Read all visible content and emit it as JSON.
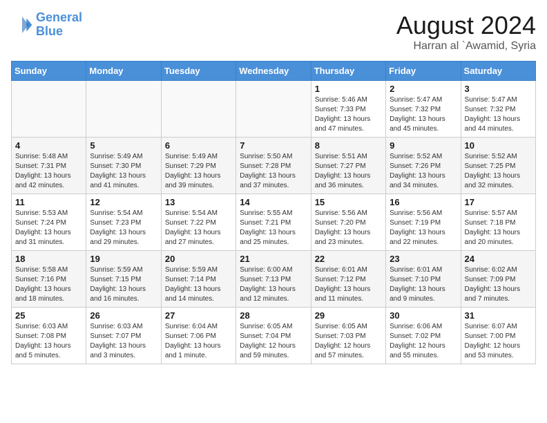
{
  "logo": {
    "line1": "General",
    "line2": "Blue"
  },
  "title": "August 2024",
  "location": "Harran al `Awamid, Syria",
  "days_of_week": [
    "Sunday",
    "Monday",
    "Tuesday",
    "Wednesday",
    "Thursday",
    "Friday",
    "Saturday"
  ],
  "weeks": [
    [
      {
        "day": "",
        "info": ""
      },
      {
        "day": "",
        "info": ""
      },
      {
        "day": "",
        "info": ""
      },
      {
        "day": "",
        "info": ""
      },
      {
        "day": "1",
        "info": "Sunrise: 5:46 AM\nSunset: 7:33 PM\nDaylight: 13 hours\nand 47 minutes."
      },
      {
        "day": "2",
        "info": "Sunrise: 5:47 AM\nSunset: 7:32 PM\nDaylight: 13 hours\nand 45 minutes."
      },
      {
        "day": "3",
        "info": "Sunrise: 5:47 AM\nSunset: 7:32 PM\nDaylight: 13 hours\nand 44 minutes."
      }
    ],
    [
      {
        "day": "4",
        "info": "Sunrise: 5:48 AM\nSunset: 7:31 PM\nDaylight: 13 hours\nand 42 minutes."
      },
      {
        "day": "5",
        "info": "Sunrise: 5:49 AM\nSunset: 7:30 PM\nDaylight: 13 hours\nand 41 minutes."
      },
      {
        "day": "6",
        "info": "Sunrise: 5:49 AM\nSunset: 7:29 PM\nDaylight: 13 hours\nand 39 minutes."
      },
      {
        "day": "7",
        "info": "Sunrise: 5:50 AM\nSunset: 7:28 PM\nDaylight: 13 hours\nand 37 minutes."
      },
      {
        "day": "8",
        "info": "Sunrise: 5:51 AM\nSunset: 7:27 PM\nDaylight: 13 hours\nand 36 minutes."
      },
      {
        "day": "9",
        "info": "Sunrise: 5:52 AM\nSunset: 7:26 PM\nDaylight: 13 hours\nand 34 minutes."
      },
      {
        "day": "10",
        "info": "Sunrise: 5:52 AM\nSunset: 7:25 PM\nDaylight: 13 hours\nand 32 minutes."
      }
    ],
    [
      {
        "day": "11",
        "info": "Sunrise: 5:53 AM\nSunset: 7:24 PM\nDaylight: 13 hours\nand 31 minutes."
      },
      {
        "day": "12",
        "info": "Sunrise: 5:54 AM\nSunset: 7:23 PM\nDaylight: 13 hours\nand 29 minutes."
      },
      {
        "day": "13",
        "info": "Sunrise: 5:54 AM\nSunset: 7:22 PM\nDaylight: 13 hours\nand 27 minutes."
      },
      {
        "day": "14",
        "info": "Sunrise: 5:55 AM\nSunset: 7:21 PM\nDaylight: 13 hours\nand 25 minutes."
      },
      {
        "day": "15",
        "info": "Sunrise: 5:56 AM\nSunset: 7:20 PM\nDaylight: 13 hours\nand 23 minutes."
      },
      {
        "day": "16",
        "info": "Sunrise: 5:56 AM\nSunset: 7:19 PM\nDaylight: 13 hours\nand 22 minutes."
      },
      {
        "day": "17",
        "info": "Sunrise: 5:57 AM\nSunset: 7:18 PM\nDaylight: 13 hours\nand 20 minutes."
      }
    ],
    [
      {
        "day": "18",
        "info": "Sunrise: 5:58 AM\nSunset: 7:16 PM\nDaylight: 13 hours\nand 18 minutes."
      },
      {
        "day": "19",
        "info": "Sunrise: 5:59 AM\nSunset: 7:15 PM\nDaylight: 13 hours\nand 16 minutes."
      },
      {
        "day": "20",
        "info": "Sunrise: 5:59 AM\nSunset: 7:14 PM\nDaylight: 13 hours\nand 14 minutes."
      },
      {
        "day": "21",
        "info": "Sunrise: 6:00 AM\nSunset: 7:13 PM\nDaylight: 13 hours\nand 12 minutes."
      },
      {
        "day": "22",
        "info": "Sunrise: 6:01 AM\nSunset: 7:12 PM\nDaylight: 13 hours\nand 11 minutes."
      },
      {
        "day": "23",
        "info": "Sunrise: 6:01 AM\nSunset: 7:10 PM\nDaylight: 13 hours\nand 9 minutes."
      },
      {
        "day": "24",
        "info": "Sunrise: 6:02 AM\nSunset: 7:09 PM\nDaylight: 13 hours\nand 7 minutes."
      }
    ],
    [
      {
        "day": "25",
        "info": "Sunrise: 6:03 AM\nSunset: 7:08 PM\nDaylight: 13 hours\nand 5 minutes."
      },
      {
        "day": "26",
        "info": "Sunrise: 6:03 AM\nSunset: 7:07 PM\nDaylight: 13 hours\nand 3 minutes."
      },
      {
        "day": "27",
        "info": "Sunrise: 6:04 AM\nSunset: 7:06 PM\nDaylight: 13 hours\nand 1 minute."
      },
      {
        "day": "28",
        "info": "Sunrise: 6:05 AM\nSunset: 7:04 PM\nDaylight: 12 hours\nand 59 minutes."
      },
      {
        "day": "29",
        "info": "Sunrise: 6:05 AM\nSunset: 7:03 PM\nDaylight: 12 hours\nand 57 minutes."
      },
      {
        "day": "30",
        "info": "Sunrise: 6:06 AM\nSunset: 7:02 PM\nDaylight: 12 hours\nand 55 minutes."
      },
      {
        "day": "31",
        "info": "Sunrise: 6:07 AM\nSunset: 7:00 PM\nDaylight: 12 hours\nand 53 minutes."
      }
    ]
  ]
}
